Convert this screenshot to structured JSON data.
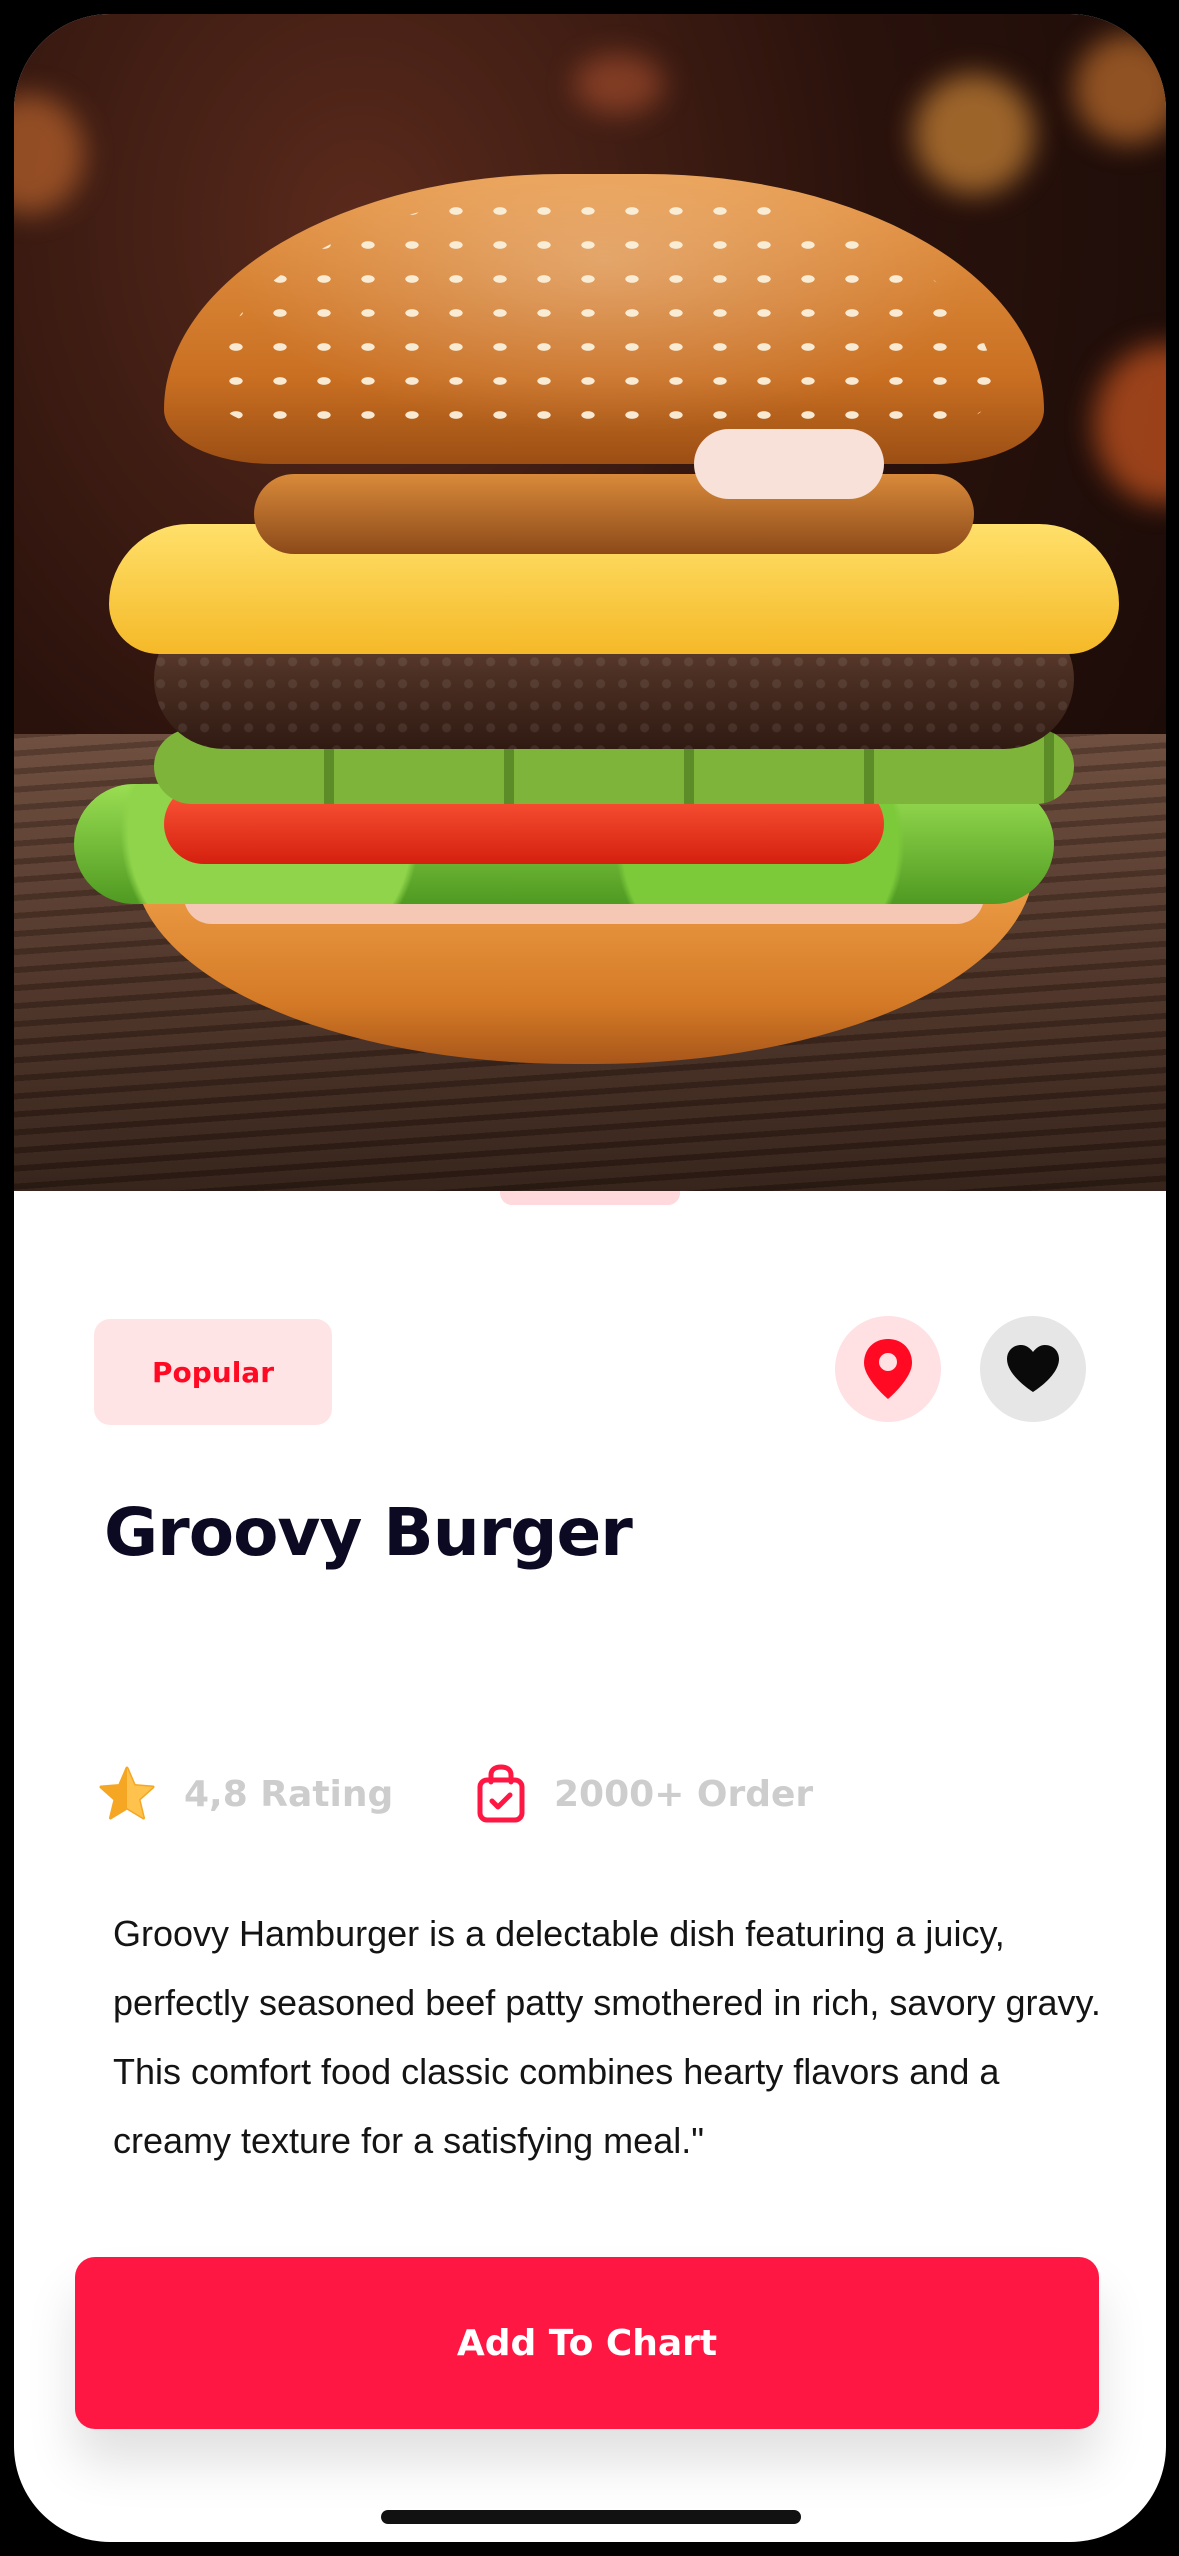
{
  "product": {
    "tag": "Popular",
    "name": "Groovy Burger",
    "rating_label": "4,8 Rating",
    "orders_label": "2000+ Order",
    "description": "Groovy Hamburger is a delectable dish featuring a juicy, perfectly seasoned beef patty smothered in rich, savory gravy. This comfort food classic combines hearty flavors and a creamy texture for a satisfying meal.\""
  },
  "actions": {
    "location_icon": "location-pin-icon",
    "favorite_icon": "heart-icon",
    "add_to_cart_label": "Add To Chart"
  },
  "icons": {
    "rating": "star-icon",
    "orders": "shopping-bag-check-icon"
  },
  "colors": {
    "accent": "#ff1744",
    "accent_text": "#ff0a22",
    "tag_bg": "#ffe4e6",
    "star": "#f5a623",
    "title": "#0c0a22",
    "muted": "#cdcdcd"
  }
}
